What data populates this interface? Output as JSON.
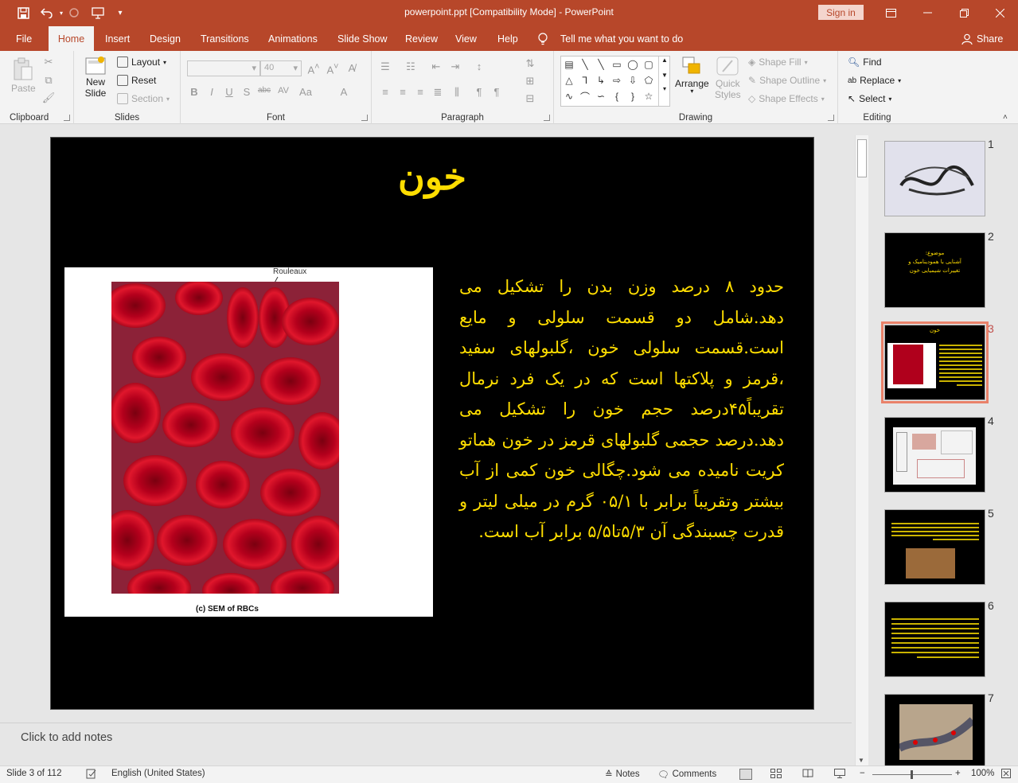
{
  "titlebar": {
    "document_title": "powerpoint.ppt [Compatibility Mode]  -  PowerPoint",
    "signin_label": "Sign in",
    "bg_color": "#b7472a"
  },
  "qat": {
    "save_icon": "save-icon",
    "undo_icon": "undo-icon",
    "redo_icon": "redo-icon",
    "present_icon": "start-from-beginning-icon"
  },
  "tabs": [
    {
      "label": "File"
    },
    {
      "label": "Home"
    },
    {
      "label": "Insert"
    },
    {
      "label": "Design"
    },
    {
      "label": "Transitions"
    },
    {
      "label": "Animations"
    },
    {
      "label": "Slide Show"
    },
    {
      "label": "Review"
    },
    {
      "label": "View"
    },
    {
      "label": "Help"
    }
  ],
  "active_tab": "Home",
  "tellme": "Tell me what you want to do",
  "share": "Share",
  "ribbon": {
    "clipboard": {
      "label": "Clipboard",
      "paste": "Paste"
    },
    "slides": {
      "label": "Slides",
      "new_slide_1": "New",
      "new_slide_2": "Slide",
      "layout": "Layout",
      "reset": "Reset",
      "section": "Section"
    },
    "font": {
      "label": "Font",
      "font_size": "40"
    },
    "paragraph": {
      "label": "Paragraph"
    },
    "drawing": {
      "label": "Drawing",
      "arrange": "Arrange",
      "quick_styles_1": "Quick",
      "quick_styles_2": "Styles",
      "shape_fill": "Shape Fill",
      "shape_outline": "Shape Outline",
      "shape_effects": "Shape Effects"
    },
    "editing": {
      "label": "Editing",
      "find": "Find",
      "replace": "Replace",
      "select": "Select"
    }
  },
  "slide": {
    "title": "خون",
    "body": "حدود ۸ درصد وزن بدن را تشکیل می دهد.شامل دو قسمت سلولی و مایع است.قسمت سلولی خون ،گلبولهای سفید ،قرمز و پلاکتها است که در یک فرد نرمال تقریباً۴۵درصد حجم خون را تشکیل می دهد.درصد حجمی گلبولهای قرمز در خون هماتو کریت نامیده می شود.چگالی خون کمی از آب بیشتر وتقریباً برابر با ۰۵/۱  گرم در میلی لیتر و قدرت چسبندگی آن ۵/۳تا۵/۵ برابر آب است.",
    "image_label_rouleaux": "Rouleaux",
    "image_caption": "(c) SEM of RBCs",
    "text_color": "#ffdd00",
    "bg_color": "#000000"
  },
  "notes_placeholder": "Click to add notes",
  "thumbnails": [
    {
      "number": "1"
    },
    {
      "number": "2",
      "title_1": "موضوع:",
      "title_2": "آشنایی با همودینامیک و",
      "title_3": "تغییرات شیمیایی خون"
    },
    {
      "number": "3",
      "title": "خون"
    },
    {
      "number": "4"
    },
    {
      "number": "5"
    },
    {
      "number": "6"
    },
    {
      "number": "7"
    }
  ],
  "selected_slide": "3",
  "statusbar": {
    "slide_info": "Slide 3 of 112",
    "language": "English (United States)",
    "notes": "Notes",
    "comments": "Comments",
    "zoom": "100%",
    "zoom_level": 1.0
  }
}
